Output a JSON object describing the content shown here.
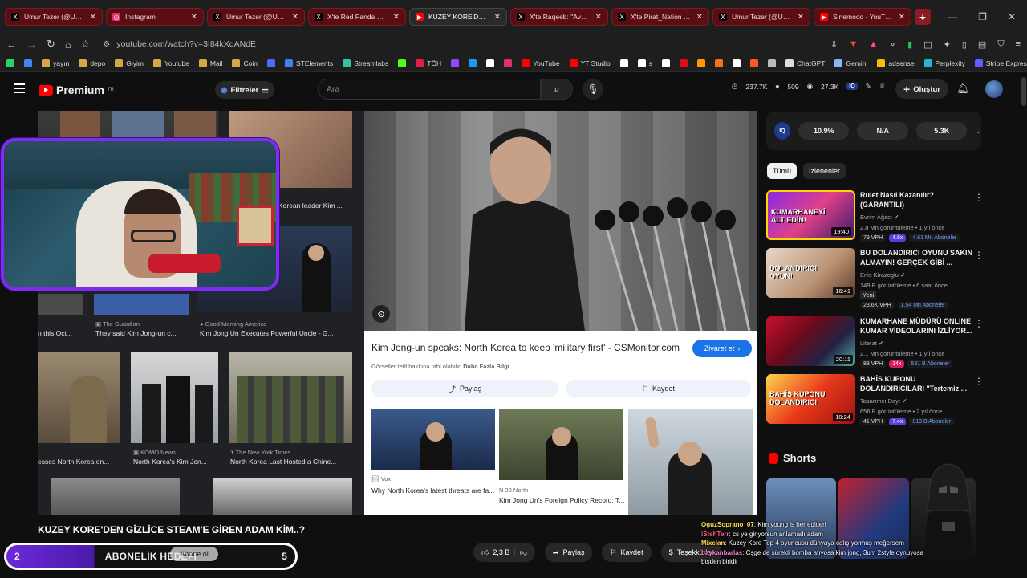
{
  "browser": {
    "tabs": [
      {
        "title": "Umur Tezer (@Umurtezer)",
        "icon": "x-icon",
        "color": "#000000"
      },
      {
        "title": "Instagram",
        "icon": "instagram-icon",
        "color": "#e1306c"
      },
      {
        "title": "Umur Tezer (@Umurtezer)",
        "icon": "x-icon",
        "color": "#000000"
      },
      {
        "title": "X'te Red Panda Koala: \"",
        "icon": "x-icon",
        "color": "#000000"
      },
      {
        "title": "KUZEY KORE'DEN G",
        "icon": "youtube-icon",
        "color": "#ff0000",
        "active": true
      },
      {
        "title": "X'te Raqeeb: \"Avengers: Ko",
        "icon": "x-icon",
        "color": "#000000"
      },
      {
        "title": "X'te Pirat_Nation : \"Mi",
        "icon": "x-icon",
        "color": "#000000"
      },
      {
        "title": "Umur Tezer (@Umurtezer)",
        "icon": "x-icon",
        "color": "#000000"
      },
      {
        "title": "Sinemood - YouTube",
        "icon": "youtube-icon",
        "color": "#ff0000"
      }
    ],
    "url": "youtube.com/watch?v=3I84kXqANdE",
    "bookmarks": [
      {
        "label": "",
        "icon": "whatsapp-icon",
        "color": "#25d366"
      },
      {
        "label": "",
        "icon": "chrome-icon",
        "color": "#4285f4"
      },
      {
        "label": "yayın",
        "icon": "folder-icon",
        "color": "#d4a843"
      },
      {
        "label": "depo",
        "icon": "folder-icon",
        "color": "#d4a843"
      },
      {
        "label": "Giyim",
        "icon": "folder-icon",
        "color": "#d4a843"
      },
      {
        "label": "Youtube",
        "icon": "folder-icon",
        "color": "#d4a843"
      },
      {
        "label": "Mail",
        "icon": "folder-icon",
        "color": "#d4a843"
      },
      {
        "label": "Coin",
        "icon": "folder-icon",
        "color": "#d4a843"
      },
      {
        "label": "",
        "icon": "r-icon",
        "color": "#4a6cf7"
      },
      {
        "label": "STElements",
        "icon": "ste-icon",
        "color": "#3b82f6"
      },
      {
        "label": "Streamlabs",
        "icon": "streamlabs-icon",
        "color": "#31c3a2"
      },
      {
        "label": "",
        "icon": "kick-icon",
        "color": "#53fc18"
      },
      {
        "label": "TÖH",
        "icon": "toh-icon",
        "color": "#e11d48"
      },
      {
        "label": "",
        "icon": "twitch-icon",
        "color": "#9146ff"
      },
      {
        "label": "",
        "icon": "bluesky-icon",
        "color": "#1d9bf0"
      },
      {
        "label": "",
        "icon": "x-icon",
        "color": "#ffffff"
      },
      {
        "label": "",
        "icon": "instagram-icon",
        "color": "#e1306c"
      },
      {
        "label": "YouTube",
        "icon": "youtube-icon",
        "color": "#ff0000"
      },
      {
        "label": "YT Studio",
        "icon": "yt-studio-icon",
        "color": "#ff0000"
      },
      {
        "label": "",
        "icon": "tiktok-icon",
        "color": "#ffffff"
      },
      {
        "label": "s",
        "icon": "tiktok-icon",
        "color": "#ffffff"
      },
      {
        "label": "",
        "icon": "circle-icon",
        "color": "#ffffff"
      },
      {
        "label": "",
        "icon": "netflix-icon",
        "color": "#e50914"
      },
      {
        "label": "",
        "icon": "amazon-icon",
        "color": "#ff9900"
      },
      {
        "label": "",
        "icon": "box-icon",
        "color": "#f97316"
      },
      {
        "label": "",
        "icon": "b-icon",
        "color": "#ffffff"
      },
      {
        "label": "",
        "icon": "blogger-icon",
        "color": "#ff5722"
      },
      {
        "label": "",
        "icon": "bank-icon",
        "color": "#bbbbbb"
      },
      {
        "label": "ChatGPT",
        "icon": "chatgpt-icon",
        "color": "#dddddd"
      },
      {
        "label": "Gemini",
        "icon": "gemini-icon",
        "color": "#8ab4f8"
      },
      {
        "label": "adsense",
        "icon": "adsense-icon",
        "color": "#fbbc04"
      },
      {
        "label": "Perplexity",
        "icon": "perplexity-icon",
        "color": "#20b8cd"
      },
      {
        "label": "Stripe Express",
        "icon": "stripe-icon",
        "color": "#635bff"
      }
    ]
  },
  "youtube": {
    "logo": "Premium",
    "logo_region": "TR",
    "filters_label": "Filtreler",
    "search_placeholder": "Ara",
    "header_stats": [
      "237.7K",
      "509",
      "27.3K"
    ],
    "create_label": "Oluştur"
  },
  "video": {
    "title": "KUZEY KORE'DEN GİZLİCE STEAM'E GİREN ADAM KİM..?",
    "goal": {
      "left": "2",
      "label": "ABONELİK HEDEFİ",
      "right": "5"
    },
    "subscribe_overlay": "Abone ol",
    "actions": {
      "likes": "2,3 B",
      "share": "Paylaş",
      "save": "Kaydet",
      "thanks": "Teşekkürler"
    }
  },
  "image_search": {
    "captions": [
      {
        "source": "",
        "text": "Korean leader Kim ..."
      },
      {
        "source": "The Guardian",
        "text": "They said Kim Jong-un c..."
      },
      {
        "source": "Good Morning America",
        "text": "Kim Jong Un Executes Powerful Uncle - G..."
      },
      {
        "source": "",
        "text": "n this Oct..."
      },
      {
        "source": "KOMO News",
        "text": "North Korea's Kim Jon..."
      },
      {
        "source": "The New York Times",
        "text": "North Korea Last Hosted a Chine..."
      },
      {
        "source": "",
        "text": "esses North Korea on..."
      }
    ],
    "panel": {
      "title": "Kim Jong-un speaks: North Korea to keep 'military first' - CSMonitor.com",
      "visit_label": "Ziyaret et",
      "note_prefix": "Görseller telif hakkına tabi olabilir.",
      "note_link": "Daha Fazla Bilgi",
      "share_label": "Paylaş",
      "save_label": "Kaydet",
      "related": [
        {
          "source": "Vox",
          "text": "Why North Korea's latest threats are fa..."
        },
        {
          "source": "38 North",
          "text": "Kim Jong Un's Foreign Policy Record: T..."
        }
      ]
    }
  },
  "sidebar": {
    "stats": [
      "10.9%",
      "N/A",
      "5.3K"
    ],
    "iq_label": "IQ",
    "chips": [
      "Tümü",
      "İzlenenler"
    ],
    "recommendations": [
      {
        "title": "Rulet Nasıl Kazanılır? (GARANTİLİ)",
        "channel": "Evrim Ağacı",
        "meta": "2,8 Mn görüntüleme • 1 yıl önce",
        "duration": "19:40",
        "vph": "79 VPH",
        "mult": "4.6x",
        "subs": "4.61 Mn Aboneler",
        "thumb_text": "KUMARHANEYİ ALT EDİN!",
        "badge": ""
      },
      {
        "title": "BU DOLANDIRICI OYUNU SAKIN ALMAYIN! GERÇEK GİBİ ...",
        "channel": "Enis Kirazoglu",
        "meta": "149 B görüntüleme • 6 saat önce",
        "duration": "16:41",
        "vph": "23.6K VPH",
        "mult": "",
        "subs": "1,54 Mn Aboneler",
        "thumb_text": "DOLANDIRICI OYUN!",
        "badge": "Yeni"
      },
      {
        "title": "KUMARHANE MÜDÜRÜ ONLINE KUMAR VİDEOLARINI İZLİYOR...",
        "channel": "Literat",
        "meta": "2,1 Mn görüntüleme • 1 yıl önce",
        "duration": "20:11",
        "vph": "88 VPH",
        "mult": "14x",
        "subs": "581 B Aboneler",
        "thumb_text": "",
        "badge": ""
      },
      {
        "title": "BAHİS KUPONU DOLANDIRICILARI \"Tertemiz ...",
        "channel": "Tasarımcı Dayı",
        "meta": "656 B görüntüleme • 2 yıl önce",
        "duration": "10:24",
        "vph": "41 VPH",
        "mult": "7.4x",
        "subs": "819 B Aboneler",
        "thumb_text": "BAHİS KUPONU DOLANDIRICI",
        "badge": ""
      }
    ],
    "shorts_label": "Shorts"
  },
  "chat": [
    {
      "user": "OguzSoprano_07",
      "text": "Kim young is her editleri"
    },
    {
      "user": "iStehTerr",
      "text": "cs ye giriyorsun anlamadı adam"
    },
    {
      "user": "Mixelan",
      "text": "Kuzey Kore Top 4 oyuncusu dünyaya çalışıyormuş meğersem"
    },
    {
      "user": "baykanbarlas",
      "text": "Cşge de sürekli bomba atıyosa kim jong, 3um 2style oynuyosa btsden biridir"
    }
  ],
  "colors": {
    "accent": "#ff0000",
    "webcam_border": "#7d2cf0",
    "visit_button": "#1a73e8"
  }
}
